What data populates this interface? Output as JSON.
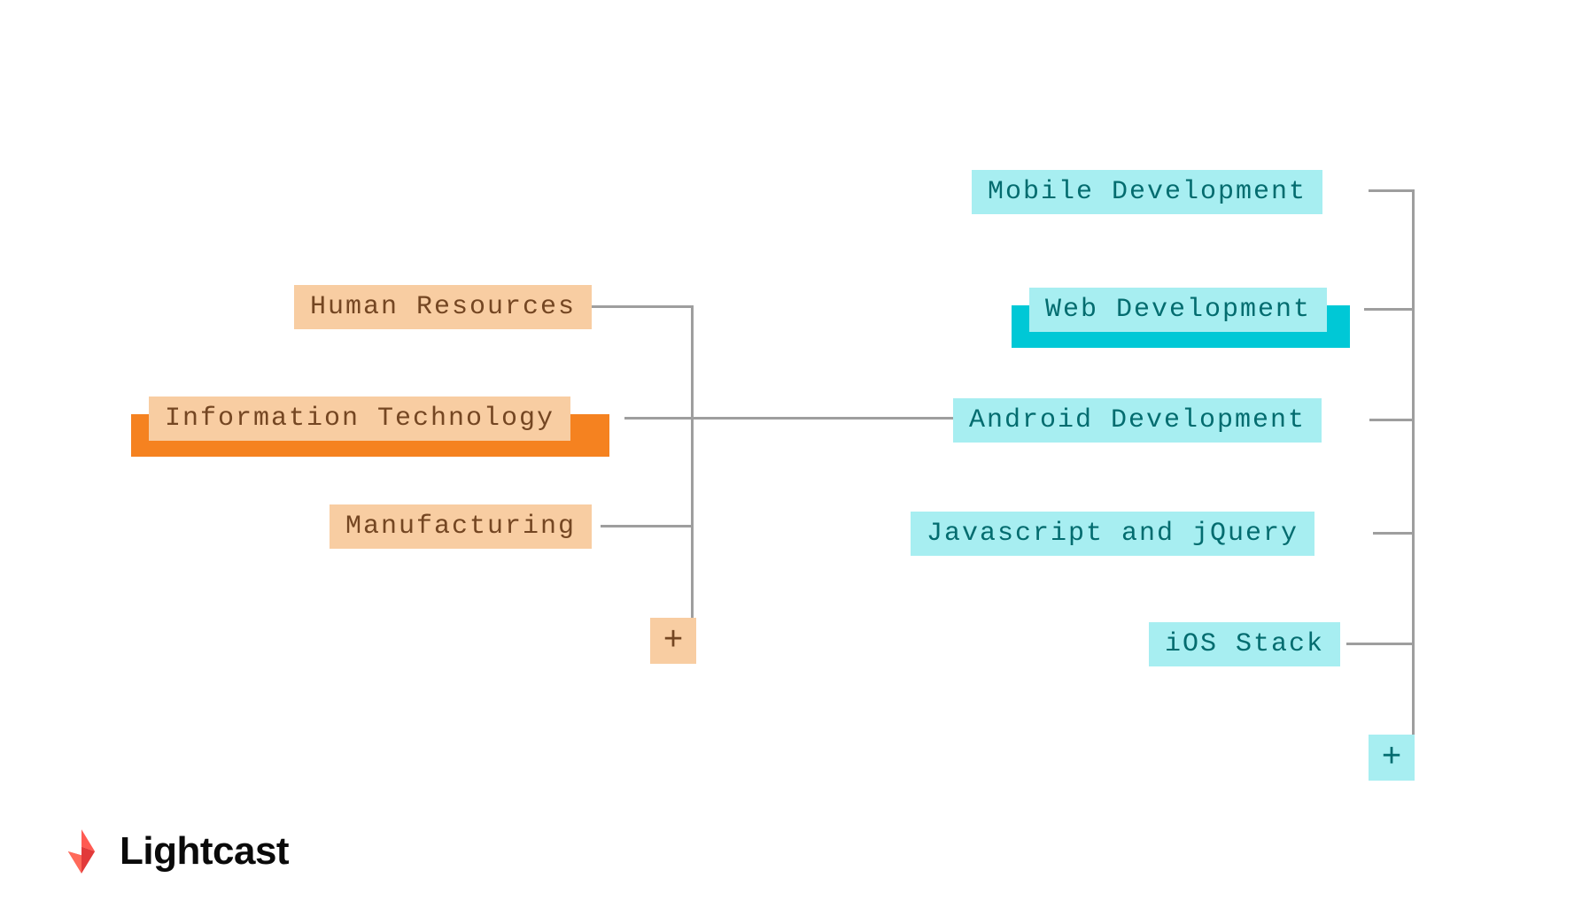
{
  "brand": {
    "name": "Lightcast"
  },
  "colors": {
    "orange_light": "#f8cda2",
    "orange_dark": "#f58220",
    "orange_text": "#744622",
    "blue_light": "#a7eef1",
    "blue_dark": "#00c8d6",
    "blue_text": "#036c6f",
    "connector": "#9e9e9e"
  },
  "left": {
    "items": [
      {
        "label": "Human Resources",
        "selected": false
      },
      {
        "label": "Information Technology",
        "selected": true
      },
      {
        "label": "Manufacturing",
        "selected": false
      }
    ],
    "plus": "+"
  },
  "right": {
    "items": [
      {
        "label": "Mobile Development",
        "selected": false
      },
      {
        "label": "Web Development",
        "selected": true
      },
      {
        "label": "Android Development",
        "selected": false
      },
      {
        "label": "Javascript and jQuery",
        "selected": false
      },
      {
        "label": "iOS Stack",
        "selected": false
      }
    ],
    "plus": "+"
  }
}
